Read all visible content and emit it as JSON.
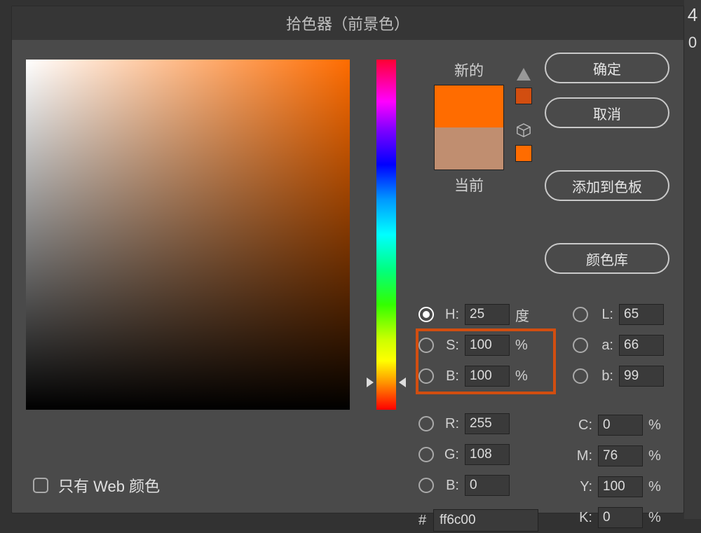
{
  "window": {
    "title": "拾色器（前景色）"
  },
  "buttons": {
    "ok": "确定",
    "cancel": "取消",
    "add_swatch": "添加到色板",
    "color_libs": "颜色库"
  },
  "preview": {
    "new_label": "新的",
    "current_label": "当前",
    "new_color": "#ff6c00",
    "current_color": "#c08e70"
  },
  "hsb": {
    "h_label": "H:",
    "h_value": "25",
    "h_unit": "度",
    "s_label": "S:",
    "s_value": "100",
    "s_unit": "%",
    "b_label": "B:",
    "b_value": "100",
    "b_unit": "%"
  },
  "lab": {
    "l_label": "L:",
    "l_value": "65",
    "a_label": "a:",
    "a_value": "66",
    "b_label": "b:",
    "b_value": "99"
  },
  "rgb": {
    "r_label": "R:",
    "r_value": "255",
    "g_label": "G:",
    "g_value": "108",
    "b_label": "B:",
    "b_value": "0"
  },
  "cmyk": {
    "c_label": "C:",
    "c_value": "0",
    "m_label": "M:",
    "m_value": "76",
    "y_label": "Y:",
    "y_value": "100",
    "k_label": "K:",
    "k_value": "0",
    "unit": "%"
  },
  "hex": {
    "label": "#",
    "value": "ff6c00"
  },
  "web_only": {
    "label": "只有 Web 颜色"
  },
  "right_edge": {
    "num4": "4",
    "num0": "0"
  }
}
